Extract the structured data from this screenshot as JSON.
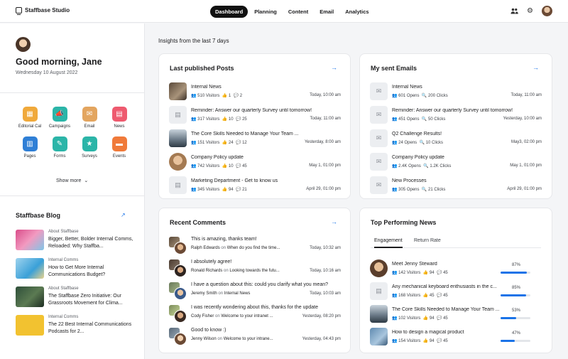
{
  "app": {
    "title": "Staffbase Studio"
  },
  "nav": [
    "Dashboard",
    "Planning",
    "Content",
    "Email",
    "Analytics"
  ],
  "nav_active": "Dashboard",
  "top_icons": [
    "people-icon",
    "gear-icon",
    "user-avatar"
  ],
  "profile": {
    "greeting": "Good morning, Jane",
    "date": "Wednesday 10 August 2022"
  },
  "apps": [
    {
      "label": "Editorial Cal",
      "icon": "calendar-icon",
      "color": "#f0a93b"
    },
    {
      "label": "Campaigns",
      "icon": "megaphone-icon",
      "color": "#2bb5a8"
    },
    {
      "label": "Email",
      "icon": "mail-icon",
      "color": "#e3a55f"
    },
    {
      "label": "News",
      "icon": "news-icon",
      "color": "#ee5a6f"
    },
    {
      "label": "Pages",
      "icon": "page-icon",
      "color": "#2f7fd6"
    },
    {
      "label": "Forms",
      "icon": "form-icon",
      "color": "#2bb5a8"
    },
    {
      "label": "Surveys",
      "icon": "survey-icon",
      "color": "#2bb5a8"
    },
    {
      "label": "Events",
      "icon": "event-icon",
      "color": "#f07a3a"
    }
  ],
  "show_more": "Show more",
  "blog": {
    "title": "Staffbase Blog",
    "items": [
      {
        "category": "About Staffbase",
        "title": "Bigger, Better, Bolder Internal Comms, Reloaded: Why Staffba...",
        "thumb_color": "#d94d8a"
      },
      {
        "category": "Internal Comms",
        "title": "How to Get More Internal Communications Budget?",
        "thumb_color": "#3aa0d8"
      },
      {
        "category": "About Staffbase",
        "title": "The Staffbase Zero Initiative: Our Grassroots Movement for Clima...",
        "thumb_color": "#2f4f3a"
      },
      {
        "category": "Internal Comms",
        "title": "The 22 Best Internal Communications Podcasts for 2...",
        "thumb_color": "#f2c230"
      }
    ]
  },
  "insights_label": "Insights from the last 7 days",
  "posts": {
    "title": "Last published Posts",
    "items": [
      {
        "title": "Internal News",
        "visitors": "510 Visitors",
        "likes": "1",
        "comments": "2",
        "time": "Today, 10:00 am",
        "thumb": "photo",
        "thumb_color": "#7a6a55"
      },
      {
        "title": "Reminder: Answer our quarterly Survey until tomorrow!",
        "visitors": "317 Visitors",
        "likes": "10",
        "comments": "25",
        "time": "Today, 11:00 am",
        "thumb": "page-icon",
        "thumb_color": "#eceef1"
      },
      {
        "title": "The Core Skills Needed to Manage Your Team ...",
        "visitors": "151 Visitors",
        "likes": "24",
        "comments": "12",
        "time": "Yesterday, 8:00 am",
        "thumb": "photo",
        "thumb_color": "#8a9aa8"
      },
      {
        "title": "Company Policy update",
        "visitors": "742 Visitors",
        "likes": "10",
        "comments": "45",
        "time": "May 1, 01:00 pm",
        "thumb": "photo",
        "thumb_color": "#c9a37a"
      },
      {
        "title": "Marketing Department - Get to know us",
        "visitors": "345 Visitors",
        "likes": "94",
        "comments": "21",
        "time": "April 29, 01:00 pm",
        "thumb": "page-icon",
        "thumb_color": "#eceef1"
      }
    ]
  },
  "emails": {
    "title": "My sent Emails",
    "items": [
      {
        "title": "Internal News",
        "opens": "601 Opens",
        "clicks": "200 Clicks",
        "time": "Today, 11:00 am"
      },
      {
        "title": "Reminder: Answer our quarterly Survey until tomorrow!",
        "opens": "451 Opens",
        "clicks": "50 Clicks",
        "time": "Yesterday, 10:00 am"
      },
      {
        "title": "Q2 Challenge Results!",
        "opens": "24 Opens",
        "clicks": "10 Clicks",
        "time": "May3, 02:00 pm"
      },
      {
        "title": "Company Policy update",
        "opens": "2.4K Opens",
        "clicks": "1.2K Clicks",
        "time": "May 1, 01:00 pm"
      },
      {
        "title": "New Processes",
        "opens": "305 Opens",
        "clicks": "21 Clicks",
        "time": "April 29, 01:00 pm"
      }
    ]
  },
  "comments": {
    "title": "Recent Comments",
    "items": [
      {
        "text": "This is amazing, thanks team!",
        "author": "Ralph Edwards",
        "on": "on",
        "post": "When do you find the time...",
        "time": "Today, 10:32 am"
      },
      {
        "text": "I absolutely agree!",
        "author": "Ronald Richards",
        "on": "on",
        "post": "Looking towards the futu...",
        "time": "Today, 10:16 am"
      },
      {
        "text": "I have a question about this: could you clarify what you mean?",
        "author": "Jeremy Smith",
        "on": "on",
        "post": "Internal News",
        "time": "Today, 10:03 am"
      },
      {
        "text": "I was recently wondering about this, thanks for the update",
        "author": "Cody Fisher",
        "on": "on",
        "post": "Welcome to your intranet ...",
        "time": "Yesterday, 08:20 pm"
      },
      {
        "text": "Good to know :)",
        "author": "Jenny Wilson",
        "on": "on",
        "post": "Welcome to your intrane...",
        "time": "Yesterday, 04:43 pm"
      }
    ]
  },
  "top_news": {
    "title": "Top Performing News",
    "tabs": [
      "Engagement",
      "Return Rate"
    ],
    "items": [
      {
        "title": "Meet Jenny Steward",
        "visitors": "142 Visitors",
        "likes": "94",
        "comments": "45",
        "percent": "87%",
        "value": 0.87,
        "thumb_color": "#8a6a50"
      },
      {
        "title": "Any mechanical keyboard enthusiasts in the c...",
        "visitors": "168 Visitors",
        "likes": "45",
        "comments": "45",
        "percent": "85%",
        "value": 0.85,
        "thumb_color": "#eceef1"
      },
      {
        "title": "The Core Skills Needed to Manage Your Team ...",
        "visitors": "102 Visitors",
        "likes": "94",
        "comments": "45",
        "percent": "53%",
        "value": 0.53,
        "thumb_color": "#8a9aa8"
      },
      {
        "title": "How to design a magical product",
        "visitors": "154 Visitors",
        "likes": "94",
        "comments": "45",
        "percent": "47%",
        "value": 0.47,
        "thumb_color": "#7fa6c8"
      }
    ]
  }
}
